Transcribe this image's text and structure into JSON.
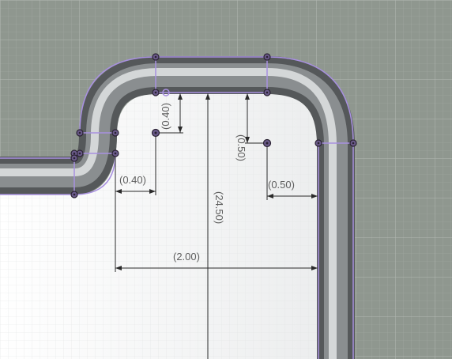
{
  "viewport": {
    "name": "CAD sketch canvas",
    "colors": {
      "background": "#8f978f",
      "panel": "#f2f3f3",
      "tube_edge": "#55585a",
      "tube_highlight": "#d4d7d8",
      "sketch_line": "#a890e0",
      "point_fill": "#6a5a8a",
      "point_dark": "#2a2232",
      "dimension_line": "#2a2a2a",
      "dimension_text": "#5e5e5e"
    }
  },
  "dimensions": {
    "offset_left_h": "(0.40)",
    "offset_left_v": "(0.40)",
    "offset_right_v": "(0.50)",
    "offset_right_h": "(0.50)",
    "overall_height": "(24.50)",
    "inner_width": "(2.00)"
  }
}
